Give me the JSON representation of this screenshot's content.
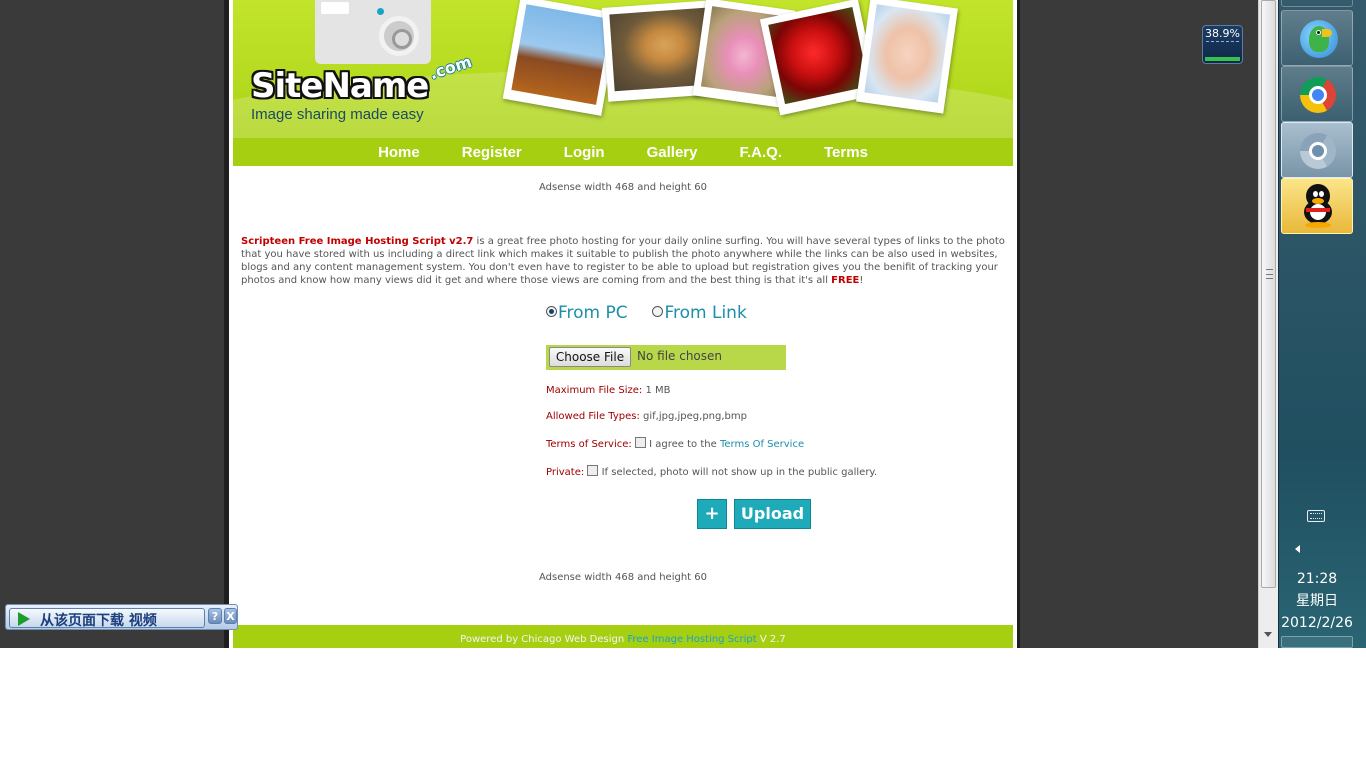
{
  "header": {
    "logo_text": "SiteName",
    "logo_com": ".com",
    "tagline": "Image sharing made easy"
  },
  "nav": {
    "items": [
      {
        "label": "Home"
      },
      {
        "label": "Register"
      },
      {
        "label": "Login"
      },
      {
        "label": "Gallery"
      },
      {
        "label": "F.A.Q."
      },
      {
        "label": "Terms"
      }
    ]
  },
  "ads": {
    "top": "Adsense width 468 and height 60",
    "bottom": "Adsense width 468 and height 60"
  },
  "intro": {
    "title": "Scripteen Free Image Hosting Script v2.7",
    "body": " is a great free photo hosting for your daily online surfing. You will have several types of links to the photo that you have stored with us including a direct link which makes it suitable to publish the photo anywhere while the links can be also used in websites, blogs and any content management system. You don't even have to register to be able to upload but registration gives you the benifit of tracking your photos and know how many views did it get and where those views are coming from and the best thing is that it's all ",
    "free": "FREE",
    "end": "!"
  },
  "upload_form": {
    "source_options": [
      {
        "label": "From PC",
        "selected": true
      },
      {
        "label": "From Link",
        "selected": false
      }
    ],
    "choose_file_label": "Choose File",
    "no_file_text": "No file chosen",
    "max_size_label": "Maximum File Size:",
    "max_size_value": "1 MB",
    "types_label": "Allowed File Types:",
    "types_value": "gif,jpg,jpeg,png,bmp",
    "tos_label": "Terms of Service:",
    "tos_text": "I agree to the",
    "tos_link": "Terms Of Service",
    "tos_checked": false,
    "private_label": "Private:",
    "private_text": "If selected, photo will not show up in the public gallery.",
    "private_checked": false,
    "plus_label": "+",
    "upload_label": "Upload"
  },
  "footer": {
    "prefix": "Powered by Chicago Web Design",
    "link": "Free Image Hosting Script",
    "suffix": "V 2.7"
  },
  "gadget": {
    "value": "38.9%"
  },
  "taskbar": {
    "apps": [
      {
        "icon": "parrot-icon",
        "active": false
      },
      {
        "icon": "chrome-icon",
        "active": false
      },
      {
        "icon": "chrome-icon",
        "active": false
      },
      {
        "icon": "qq-penguin-icon",
        "active": true
      }
    ],
    "time": "21:28",
    "weekday": "星期日",
    "date": "2012/2/26"
  },
  "download_bar": {
    "label": "从该页面下载 视频",
    "help": "?",
    "close": "X"
  },
  "colors": {
    "header_green": "#b2d81c",
    "nav_green": "#a7cf12",
    "accent_teal": "#1c8fa8",
    "label_red": "#a00000",
    "button_teal": "#1eaab8"
  }
}
